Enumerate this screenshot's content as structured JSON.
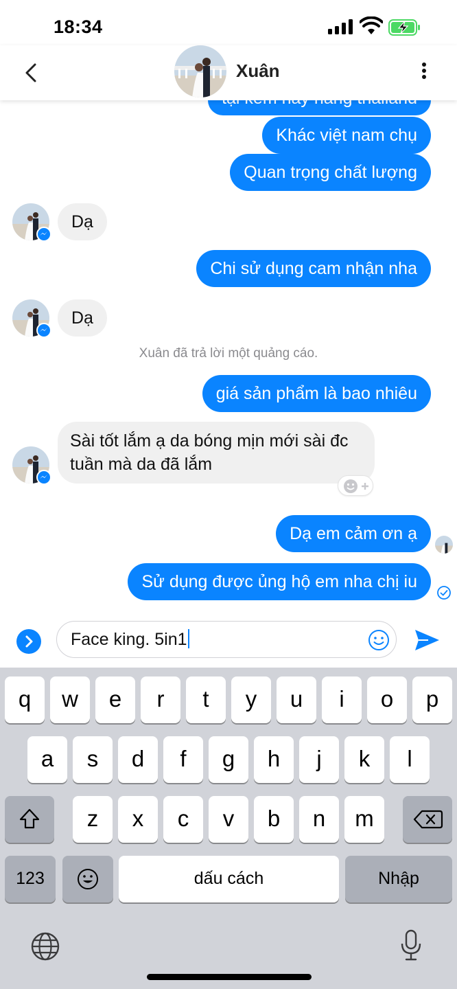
{
  "status_bar": {
    "time": "18:34"
  },
  "header": {
    "contact_name": "Xuân",
    "back_icon": "chevron-left-icon",
    "more_icon": "more-vertical-icon"
  },
  "messages": [
    {
      "side": "out",
      "text": "tại kem này hàng thailand"
    },
    {
      "side": "out",
      "text": "Khác việt nam chụ"
    },
    {
      "side": "out",
      "text": "Quan trọng chất lượng"
    },
    {
      "side": "in",
      "text": "Dạ"
    },
    {
      "side": "out",
      "text": "Chi sử dụng cam nhận nha"
    },
    {
      "side": "in",
      "text": "Dạ"
    },
    {
      "side": "system",
      "text": "Xuân đã trả lời một quảng cáo."
    },
    {
      "side": "out",
      "text": "giá sản phẩm là bao nhiêu"
    },
    {
      "side": "in",
      "text_line1": "Sài tốt lắm ạ da bóng mịn mới sài đc",
      "text_line2": "tuần mà da đã lắm"
    },
    {
      "side": "out",
      "text": "Dạ em cảm ơn ạ"
    },
    {
      "side": "out",
      "text": "Sử dụng được ủng hộ em nha chị iu"
    }
  ],
  "composer": {
    "value": "Face king. 5in1"
  },
  "keyboard": {
    "row1": [
      "q",
      "w",
      "e",
      "r",
      "t",
      "y",
      "u",
      "i",
      "o",
      "p"
    ],
    "row2": [
      "a",
      "s",
      "d",
      "f",
      "g",
      "h",
      "j",
      "k",
      "l"
    ],
    "row3": [
      "z",
      "x",
      "c",
      "v",
      "b",
      "n",
      "m"
    ],
    "numbers_label": "123",
    "space_label": "dấu cách",
    "return_label": "Nhập"
  },
  "colors": {
    "accent": "#0a84ff",
    "incoming_bubble": "#f0f0f0",
    "keyboard_bg": "#d1d3d9"
  }
}
